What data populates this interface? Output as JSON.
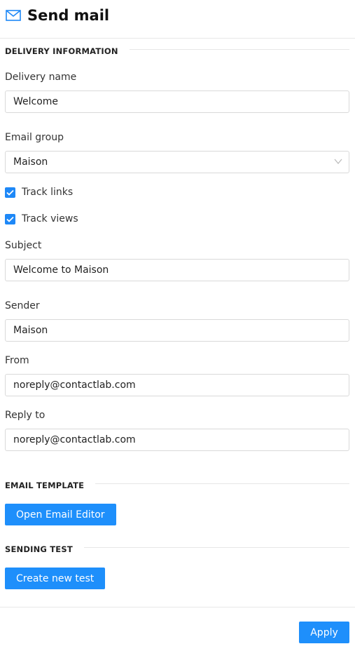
{
  "header": {
    "title": "Send mail",
    "icon": "mail-icon"
  },
  "sections": {
    "delivery": "DELIVERY INFORMATION",
    "template": "EMAIL TEMPLATE",
    "test": "SENDING TEST"
  },
  "fields": {
    "delivery_name": {
      "label": "Delivery name",
      "value": "Welcome"
    },
    "email_group": {
      "label": "Email group",
      "value": "Maison"
    },
    "subject": {
      "label": "Subject",
      "value": "Welcome to Maison"
    },
    "sender": {
      "label": "Sender",
      "value": "Maison"
    },
    "from": {
      "label": "From",
      "value": "noreply@contactlab.com"
    },
    "reply_to": {
      "label": "Reply to",
      "value": "noreply@contactlab.com"
    }
  },
  "checkboxes": {
    "track_links": {
      "label": "Track links",
      "checked": true
    },
    "track_views": {
      "label": "Track views",
      "checked": true
    }
  },
  "buttons": {
    "open_editor": "Open Email Editor",
    "create_test": "Create new test",
    "apply": "Apply"
  },
  "colors": {
    "accent": "#1e8ffb"
  }
}
